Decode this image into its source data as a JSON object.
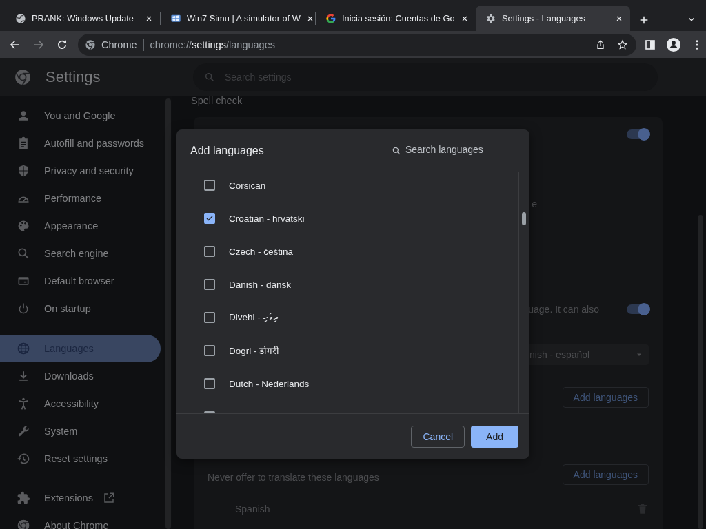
{
  "tabs": [
    {
      "title": "PRANK: Windows Update",
      "selected": false
    },
    {
      "title": "Win7 Simu | A simulator of W",
      "selected": false
    },
    {
      "title": "Inicia sesión: Cuentas de Go",
      "selected": false
    },
    {
      "title": "Settings - Languages",
      "selected": true
    }
  ],
  "address_bar": {
    "site_label": "Chrome",
    "url": "chrome://**settings**/languages"
  },
  "settings_header": {
    "title": "Settings",
    "search_placeholder": "Search settings"
  },
  "sidebar": {
    "groups": [
      {
        "items": [
          {
            "label": "You and Google",
            "selected": false
          },
          {
            "label": "Autofill and passwords",
            "selected": false
          },
          {
            "label": "Privacy and security",
            "selected": false
          },
          {
            "label": "Performance",
            "selected": false
          },
          {
            "label": "Appearance",
            "selected": false
          },
          {
            "label": "Search engine",
            "selected": false
          },
          {
            "label": "Default browser",
            "selected": false
          },
          {
            "label": "On startup",
            "selected": false
          }
        ]
      },
      {
        "items": [
          {
            "label": "Languages",
            "selected": true
          },
          {
            "label": "Downloads",
            "selected": false
          },
          {
            "label": "Accessibility",
            "selected": false
          },
          {
            "label": "System",
            "selected": false
          },
          {
            "label": "Reset settings",
            "selected": false
          }
        ]
      },
      {
        "items": [
          {
            "label": "Extensions",
            "selected": false,
            "kind": "external"
          },
          {
            "label": "About Chrome",
            "selected": false,
            "kind": "page"
          }
        ]
      }
    ]
  },
  "main": {
    "section_title": "Spell check",
    "spell_check_on": true,
    "fragment_1": "e",
    "fragment_2": "uage. It can also",
    "translate_on": true,
    "target_language": "nish - español",
    "add_button": "Add languages",
    "never_label": "Never offer to translate these languages",
    "never_add_button": "Add languages",
    "never_languages": [
      "Spanish"
    ]
  },
  "dialog": {
    "title": "Add languages",
    "search_placeholder": "Search languages",
    "languages": [
      {
        "label": "Corsican",
        "checked": false
      },
      {
        "label": "Croatian - hrvatski",
        "checked": true
      },
      {
        "label": "Czech - čeština",
        "checked": false
      },
      {
        "label": "Danish - dansk",
        "checked": false
      },
      {
        "label": "Divehi - ދިވެހި",
        "checked": false
      },
      {
        "label": "Dogri - डोगरी",
        "checked": false
      },
      {
        "label": "Dutch - Nederlands",
        "checked": false
      },
      {
        "checked": false
      }
    ],
    "buttons": [
      {
        "label": "Cancel",
        "kind": "secondary"
      },
      {
        "label": "Add",
        "kind": "primary"
      }
    ]
  }
}
